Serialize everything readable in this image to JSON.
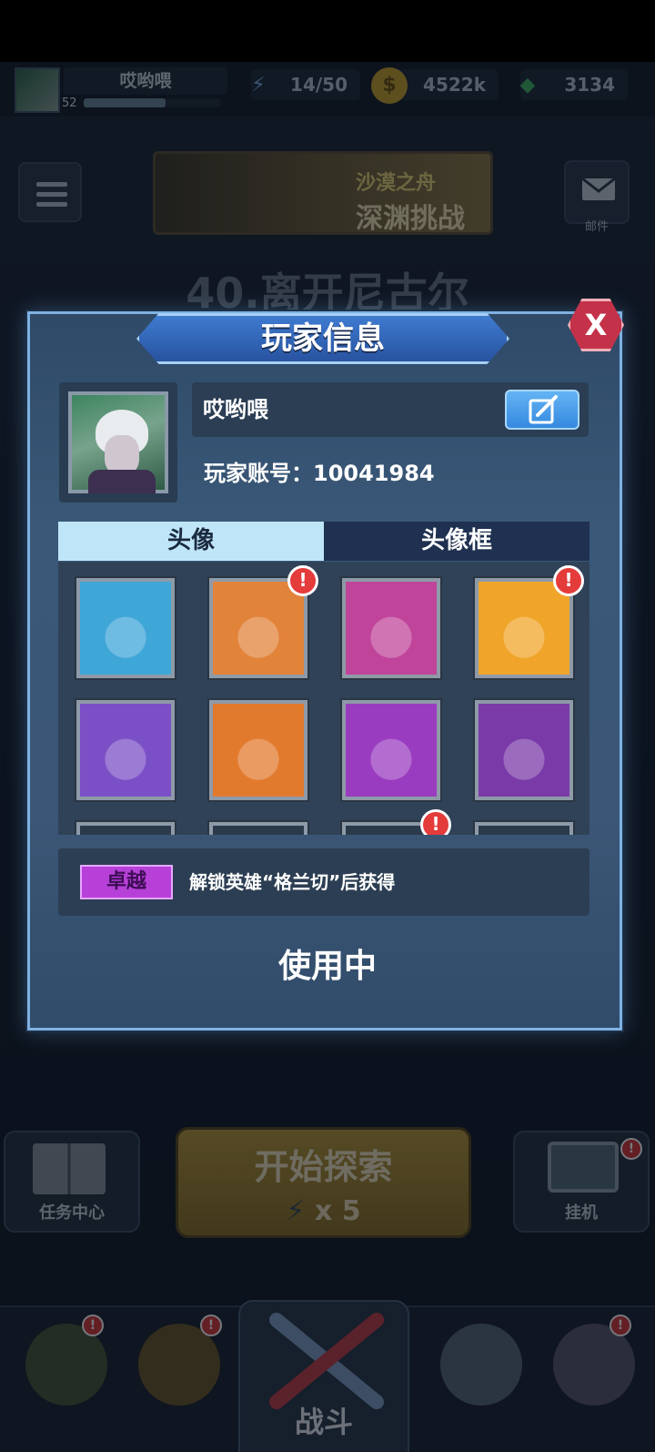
{
  "topbar": {
    "player_name": "哎哟喂",
    "level": "52",
    "xp_fraction": 0.6,
    "energy": "14/50",
    "gold": "4522k",
    "gems": "3134"
  },
  "background": {
    "banner_line1": "沙漠之舟",
    "banner_line2": "深渊挑战",
    "chapter_title": "40.离开尼古尔",
    "mail_label": "邮件",
    "task_center_label": "任务中心",
    "idle_label": "挂机",
    "start_label": "开始探索",
    "start_cost": "x 5",
    "battle_tab_label": "战斗"
  },
  "modal": {
    "title": "玩家信息",
    "close_label": "X",
    "player_name": "哎哟喂",
    "account_label": "玩家账号：",
    "account_id": "10041984",
    "tab_avatar": "头像",
    "tab_frame": "头像框",
    "avatars": [
      {
        "icon": "white-haired-knight-avatar-icon",
        "alert": false,
        "bg": "#3fa6d8"
      },
      {
        "icon": "goggled-engineer-avatar-icon",
        "alert": true,
        "bg": "#e2833a"
      },
      {
        "icon": "blonde-pilot-avatar-icon",
        "alert": false,
        "bg": "#c0459a"
      },
      {
        "icon": "blue-haired-girl-avatar-icon",
        "alert": true,
        "bg": "#f0a42a"
      },
      {
        "icon": "armored-soldier-avatar-icon",
        "alert": false,
        "bg": "#7b4fc6"
      },
      {
        "icon": "mech-crab-avatar-icon",
        "alert": false,
        "bg": "#e27a2e"
      },
      {
        "icon": "spiked-beast-avatar-icon",
        "alert": false,
        "bg": "#9a3cc0"
      },
      {
        "icon": "alien-bug-avatar-icon",
        "alert": false,
        "bg": "#7a3aa8"
      }
    ],
    "alert_symbol": "!",
    "quality_badge": "卓越",
    "unlock_text": "解锁英雄“格兰切”后获得",
    "in_use_label": "使用中"
  },
  "colors": {
    "modal_border": "#7fb2e2",
    "title_bar": "#3f7bd0",
    "tab_active": "#bfe6f8",
    "quality_purple": "#b640d8",
    "alert_red": "#e43b3b"
  }
}
